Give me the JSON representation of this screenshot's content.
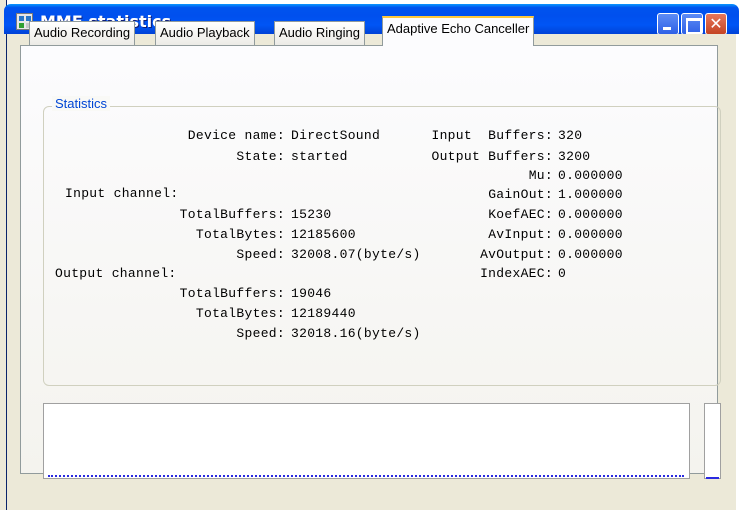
{
  "window": {
    "title": "MME statistics",
    "icon": "app-icon",
    "controls": [
      "minimize-icon",
      "maximize-icon",
      "close-icon"
    ]
  },
  "tabs": [
    {
      "label": "Audio Recording",
      "active": false
    },
    {
      "label": "Audio Playback",
      "active": false
    },
    {
      "label": "Audio Ringing",
      "active": false
    },
    {
      "label": "Adaptive Echo Canceller",
      "active": true
    }
  ],
  "statistics": {
    "group_title": "Statistics",
    "left": [
      {
        "label": "Device name:",
        "value": "DirectSound"
      },
      {
        "label": "State:",
        "value": "started"
      },
      {
        "label": "Input channel:",
        "value": ""
      },
      {
        "label": "TotalBuffers:",
        "value": "15230"
      },
      {
        "label": "TotalBytes:",
        "value": "12185600"
      },
      {
        "label": "Speed:",
        "value": "32008.07(byte/s)"
      },
      {
        "label": "Output channel:",
        "value": ""
      },
      {
        "label": "TotalBuffers:",
        "value": "19046"
      },
      {
        "label": "TotalBytes:",
        "value": "12189440"
      },
      {
        "label": "Speed:",
        "value": "32018.16(byte/s)"
      }
    ],
    "right": [
      {
        "label": "Input  Buffers:",
        "value": "320"
      },
      {
        "label": "Output Buffers:",
        "value": "3200"
      },
      {
        "label": "Mu:",
        "value": "0.000000"
      },
      {
        "label": "GainOut:",
        "value": "1.000000"
      },
      {
        "label": "KoefAEC:",
        "value": "0.000000"
      },
      {
        "label": "AvInput:",
        "value": "0.000000"
      },
      {
        "label": "AvOutput:",
        "value": "0.000000"
      },
      {
        "label": "IndexAEC:",
        "value": "0"
      }
    ]
  },
  "colors": {
    "title_bar": "#0053ee",
    "group_title": "#0046d5",
    "waveform": "#2a2ae0",
    "active_tab_accent": "#ffc83c"
  }
}
